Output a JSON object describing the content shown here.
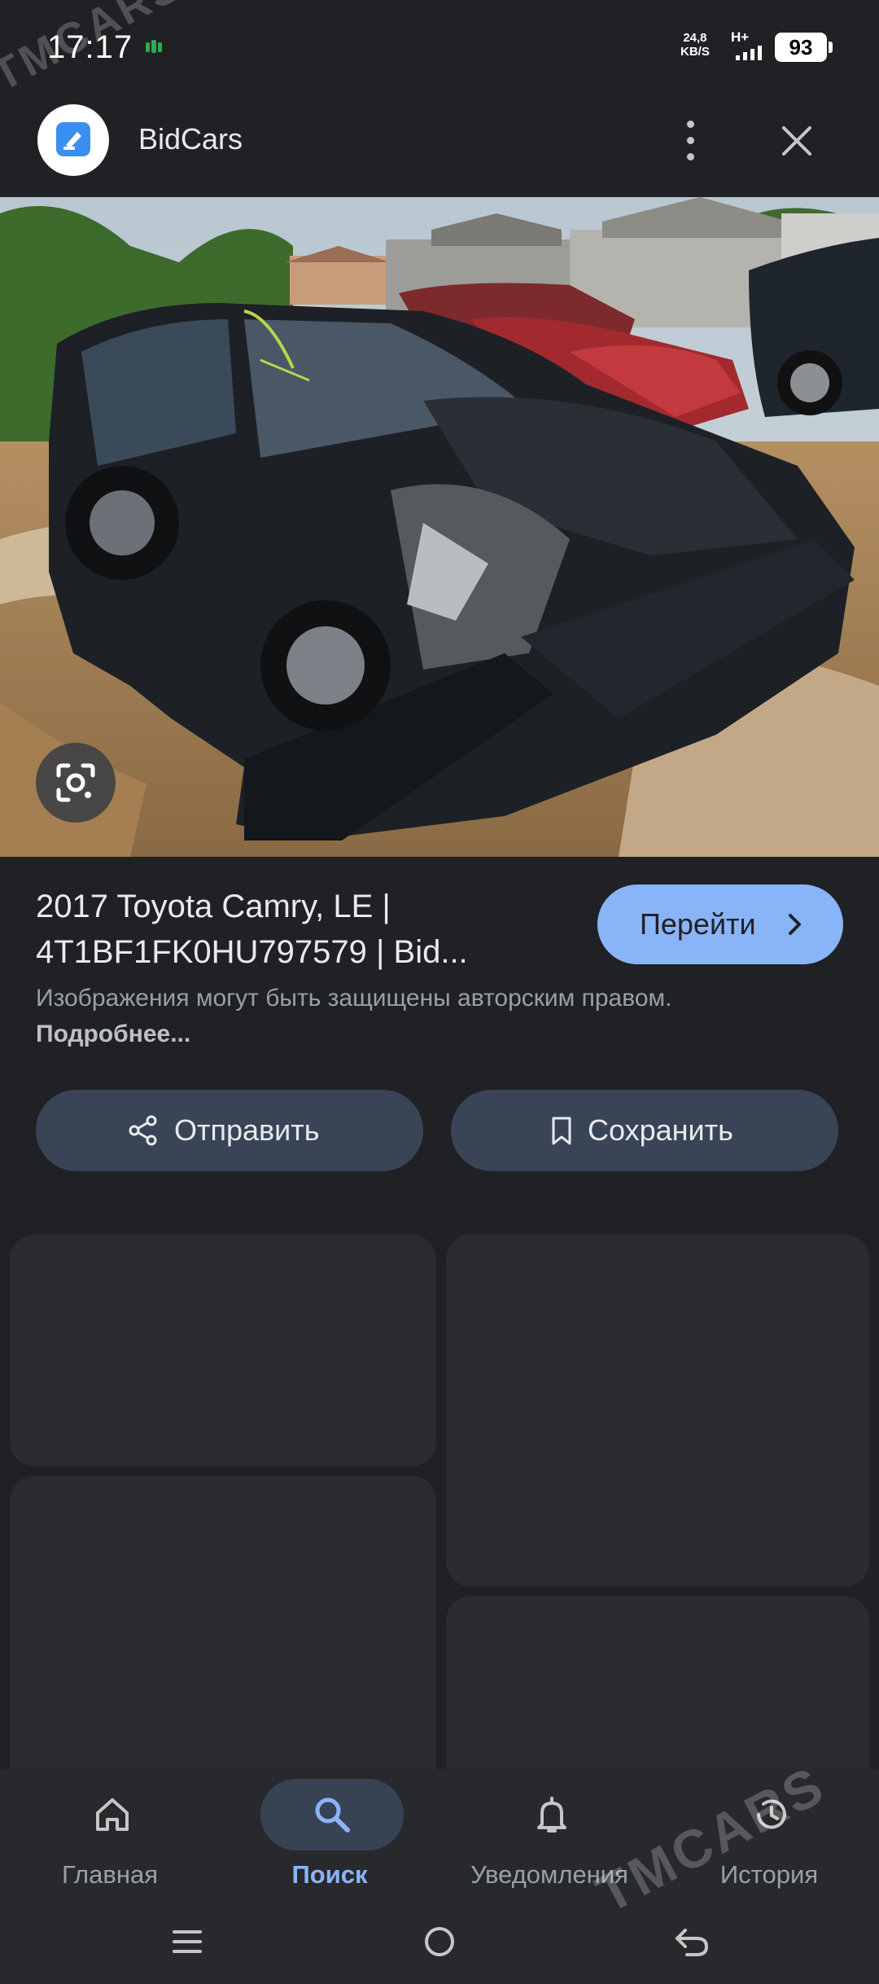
{
  "status_bar": {
    "time": "17:17",
    "speed_value": "24,8",
    "speed_unit": "KB/S",
    "network": "H+",
    "battery": "93"
  },
  "header": {
    "app_name": "BidCars",
    "logo_icon": "bidcars-logo-icon",
    "more_icon": "more-vert-icon",
    "close_icon": "close-icon"
  },
  "result": {
    "title": "2017 Toyota Camry, LE | 4T1BF1FK0HU797579 | Bid...",
    "go_label": "Перейти",
    "copyright_text": "Изображения могут быть защищены авторским правом.",
    "more_link": "Подробнее..."
  },
  "actions": {
    "share_label": "Отправить",
    "save_label": "Сохранить"
  },
  "nav": {
    "items": [
      {
        "label": "Главная",
        "icon": "home-icon",
        "active": false
      },
      {
        "label": "Поиск",
        "icon": "search-icon",
        "active": true
      },
      {
        "label": "Уведомления",
        "icon": "bell-icon",
        "active": false
      },
      {
        "label": "История",
        "icon": "history-icon",
        "active": false
      }
    ]
  },
  "watermark": {
    "text": "TMCARS"
  },
  "colors": {
    "background": "#202124",
    "accent": "#8ab4f8",
    "button": "#394457",
    "nav_bg": "#28292d"
  }
}
